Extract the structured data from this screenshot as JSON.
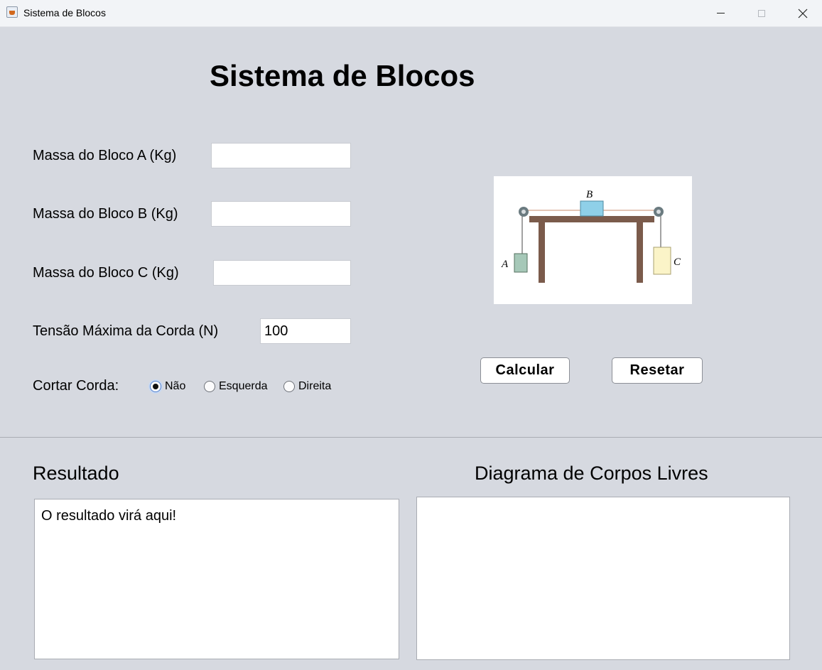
{
  "window": {
    "title": "Sistema de Blocos"
  },
  "form": {
    "heading": "Sistema de Blocos",
    "mass_a_label": "Massa do Bloco A (Kg)",
    "mass_a_value": "",
    "mass_b_label": "Massa do Bloco B (Kg)",
    "mass_b_value": "",
    "mass_c_label": "Massa do Bloco C (Kg)",
    "mass_c_value": "",
    "tension_label": "Tensão Máxima da Corda (N)",
    "tension_value": "100",
    "cut_label": "Cortar Corda:",
    "cut_options": [
      {
        "label": "Não",
        "selected": true
      },
      {
        "label": "Esquerda",
        "selected": false
      },
      {
        "label": "Direita",
        "selected": false
      }
    ]
  },
  "figure": {
    "label_a": "A",
    "label_b": "B",
    "label_c": "C"
  },
  "buttons": {
    "calculate": "Calcular",
    "reset": "Resetar"
  },
  "result": {
    "title": "Resultado",
    "text": "O resultado virá aqui!"
  },
  "diagram": {
    "title": "Diagrama de Corpos Livres"
  }
}
